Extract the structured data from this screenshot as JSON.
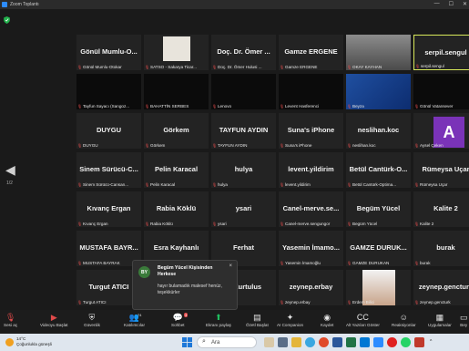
{
  "window": {
    "title": "Zoom Toplantı",
    "controls": [
      "—",
      "☐",
      "✕"
    ]
  },
  "page_indicator": "1/2",
  "tiles": [
    {
      "name": "Gönül Mumlu-O...",
      "label": "Gönül Mumlu-Otokar"
    },
    {
      "name": "",
      "label": "SATSO - Sakarya Ticar..."
    },
    {
      "name": "Doç. Dr. Ömer ...",
      "label": "Doç. Dr. Ömer Hulusi ..."
    },
    {
      "name": "Gamze ERGENE",
      "label": "Gamze ERGENE"
    },
    {
      "name": "",
      "label": "OKAY KAYHAN"
    },
    {
      "name": "serpil.sengul",
      "label": "serpil.sengul"
    },
    {
      "name": "",
      "label": "Tayfun Sayacı (Sangoz..."
    },
    {
      "name": "",
      "label": "BAHATTİN SERBES"
    },
    {
      "name": "",
      "label": "Lenovo"
    },
    {
      "name": "",
      "label": "Levent Hasferenci"
    },
    {
      "name": "",
      "label": "Beyza"
    },
    {
      "name": "",
      "label": "Gönül Vatansever"
    },
    {
      "name": "DUYGU",
      "label": "DUYGU"
    },
    {
      "name": "Görkem",
      "label": "Görkem"
    },
    {
      "name": "TAYFUN AYDIN",
      "label": "TAYFUN AYDIN"
    },
    {
      "name": "Suna's iPhone",
      "label": "Suna's iPhone"
    },
    {
      "name": "neslihan.koc",
      "label": "neslihan.koc"
    },
    {
      "name": "",
      "label": "Aysel Çeken"
    },
    {
      "name": "Sinem Sürücü-C...",
      "label": "Sinem Sürücü-Cansan..."
    },
    {
      "name": "Pelin Karacal",
      "label": "Pelin Karacal"
    },
    {
      "name": "hulya",
      "label": "hulya"
    },
    {
      "name": "levent.yildirim",
      "label": "levent.yildirim"
    },
    {
      "name": "Betül Cantürk-O...",
      "label": "Betül Cantürk-Optima..."
    },
    {
      "name": "Rümeysa Uçar",
      "label": "Rümeysa Uçar"
    },
    {
      "name": "Kıvanç Ergan",
      "label": "Kıvanç Ergan"
    },
    {
      "name": "Rabia Köklü",
      "label": "Rabia Köklü"
    },
    {
      "name": "ysari",
      "label": "ysari"
    },
    {
      "name": "Canel-merve.se...",
      "label": "Canel-merve.sengungor"
    },
    {
      "name": "Begüm Yücel",
      "label": "Begüm Yücel"
    },
    {
      "name": "Kalite 2",
      "label": "Kalite 2"
    },
    {
      "name": "MUSTAFA BAYR...",
      "label": "MUSTAFA BAYRAK"
    },
    {
      "name": "Esra Kayhanlı",
      "label": "Esra Kayhanlı"
    },
    {
      "name": "Ferhat",
      "label": "Ferhat"
    },
    {
      "name": "Yasemin İmamo...",
      "label": "Yasemin İmamoğlu"
    },
    {
      "name": "GAMZE DURUK...",
      "label": "GAMZE DURUKAN"
    },
    {
      "name": "burak",
      "label": "burak"
    },
    {
      "name": "Turgut ATICI",
      "label": "Turgut ATICI"
    },
    {
      "name": "",
      "label": ""
    },
    {
      "name": "el Kurtulus",
      "label": ""
    },
    {
      "name": "zeynep.erbay",
      "label": "zeynep.erbay"
    },
    {
      "name": "",
      "label": "Erdem Bilici"
    },
    {
      "name": "zeynep.gencturk",
      "label": "zeynep.gencturk"
    }
  ],
  "toast": {
    "initials": "BY",
    "title": "Begüm Yücel Kişisinden Herkese",
    "message": "hayır bulamadık malesef henüz, teşekkürler",
    "close": "×"
  },
  "toolbar": {
    "items": [
      {
        "label": "Sesi aç",
        "icon": "mic-muted-icon"
      },
      {
        "label": "Videoyu Başlat",
        "icon": "video-off-icon"
      },
      {
        "label": "Güvenlik",
        "icon": "shield-icon"
      },
      {
        "label": "Katılımcılar",
        "icon": "participants-icon",
        "count": "74"
      },
      {
        "label": "Sohbet",
        "icon": "chat-icon",
        "count": "3"
      },
      {
        "label": "Ekranı paylaş",
        "icon": "share-screen-icon"
      },
      {
        "label": "Özetl Başlat",
        "icon": "summary-icon"
      },
      {
        "label": "AI Companion",
        "icon": "ai-companion-icon"
      },
      {
        "label": "Kaydet",
        "icon": "record-icon"
      },
      {
        "label": "Alt Yazıları Göster",
        "icon": "captions-icon"
      },
      {
        "label": "Reaksiyonlar",
        "icon": "reactions-icon"
      },
      {
        "label": "Uygulamalar",
        "icon": "apps-icon"
      },
      {
        "label": "Bey",
        "icon": "whiteboard-icon"
      }
    ]
  },
  "taskbar": {
    "weather": {
      "temp": "14°C",
      "desc": "Çoğunlukla güneşli"
    },
    "search_placeholder": "Ara",
    "tray": "^"
  }
}
